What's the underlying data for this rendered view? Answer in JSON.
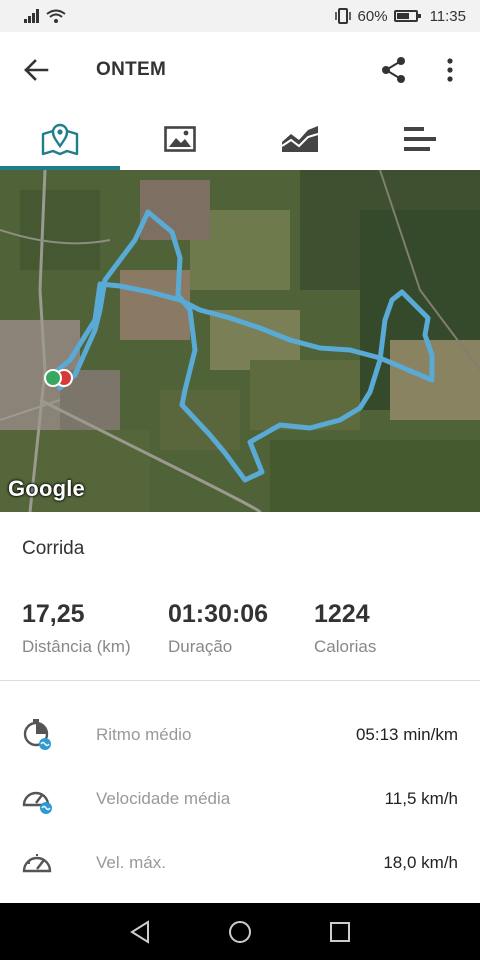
{
  "status_bar": {
    "battery_percent": "60%",
    "time": "11:35"
  },
  "header": {
    "title": "ONTEM",
    "icons": [
      "arrow-back-icon",
      "share-icon",
      "more-vert-icon"
    ]
  },
  "tabs": [
    {
      "icon": "map-icon",
      "active": true
    },
    {
      "icon": "image-icon",
      "active": false
    },
    {
      "icon": "chart-icon",
      "active": false
    },
    {
      "icon": "bars-icon",
      "active": false
    }
  ],
  "map": {
    "attribution": "Google",
    "route_color": "#5aaad6"
  },
  "summary": {
    "activity_type": "Corrida",
    "stats": [
      {
        "value": "17,25",
        "label": "Distância (km)"
      },
      {
        "value": "01:30:06",
        "label": "Duração"
      },
      {
        "value": "1224",
        "label": "Calorias"
      }
    ]
  },
  "details": [
    {
      "label": "Ritmo médio",
      "value": "05:13 min/km",
      "icon": "pace-icon"
    },
    {
      "label": "Velocidade média",
      "value": "11,5 km/h",
      "icon": "speed-icon"
    },
    {
      "label": "Vel. máx.",
      "value": "18,0 km/h",
      "icon": "max-speed-icon"
    }
  ],
  "colors": {
    "accent": "#1e7f8a",
    "badge": "#2c9bd2"
  }
}
